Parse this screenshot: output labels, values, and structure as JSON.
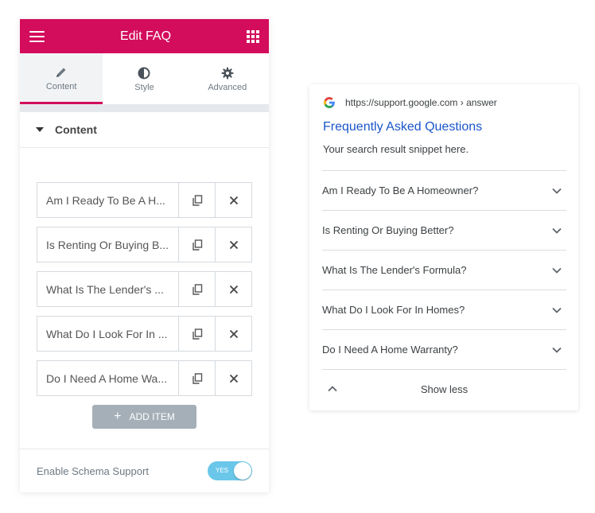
{
  "editor": {
    "title": "Edit FAQ",
    "tabs": [
      {
        "label": "Content",
        "icon": "pencil-icon",
        "active": true
      },
      {
        "label": "Style",
        "icon": "contrast-icon",
        "active": false
      },
      {
        "label": "Advanced",
        "icon": "gear-icon",
        "active": false
      }
    ],
    "section_title": "Content",
    "items": [
      {
        "label": "Am I Ready To Be A H..."
      },
      {
        "label": "Is Renting Or Buying B..."
      },
      {
        "label": "What Is The Lender's ..."
      },
      {
        "label": "What Do I Look For In ..."
      },
      {
        "label": "Do I Need A Home Wa..."
      }
    ],
    "add_item_label": "ADD ITEM",
    "schema_label": "Enable Schema Support",
    "schema_toggle": {
      "label": "YES",
      "on": true
    },
    "accent_color": "#d30c5c"
  },
  "serp": {
    "url": "https://support.google.com › answer",
    "title": "Frequently Asked Questions",
    "snippet": "Your search result snippet here.",
    "faqs": [
      {
        "question": "Am I Ready To Be A Homeowner?"
      },
      {
        "question": "Is Renting Or Buying Better?"
      },
      {
        "question": "What Is The Lender's Formula?"
      },
      {
        "question": "What Do I Look For In Homes?"
      },
      {
        "question": "Do I Need A Home Warranty?"
      }
    ],
    "show_less_label": "Show less",
    "link_color": "#1a56c8"
  }
}
